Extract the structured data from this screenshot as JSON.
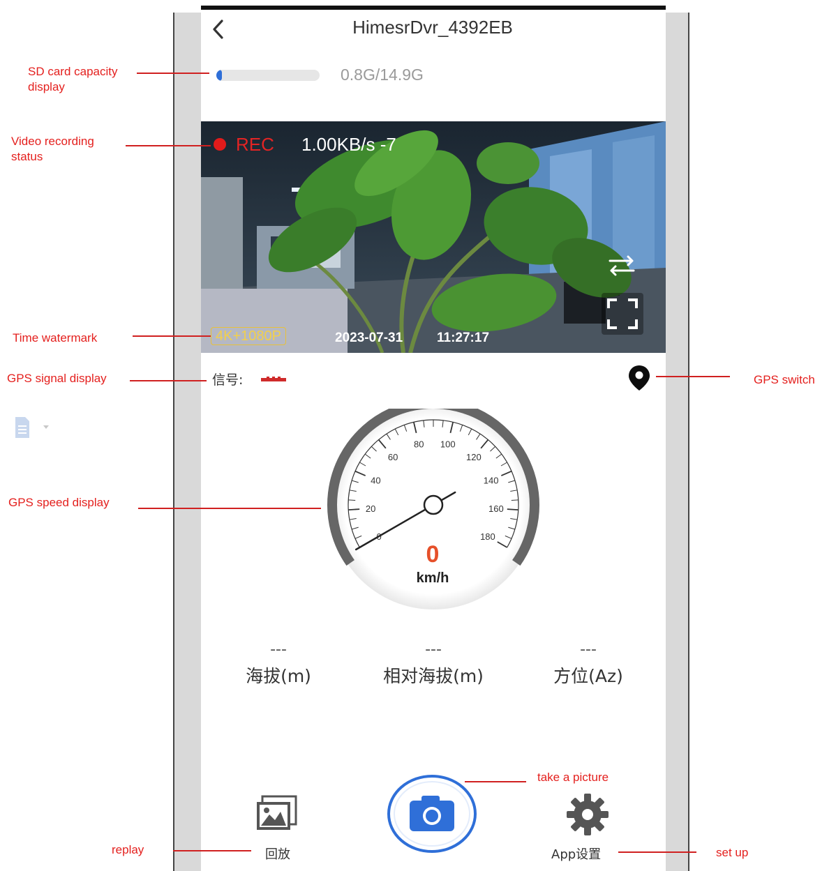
{
  "header": {
    "title": "HimesrDvr_4392EB"
  },
  "storage": {
    "used_fraction": 0.054,
    "label": "0.8G/14.9G"
  },
  "video": {
    "rec_label": "REC",
    "bitrate": "1.00KB/s -7",
    "resolution_badge": "4K+1080P",
    "date": "2023-07-31",
    "time": "11:27:17"
  },
  "gps": {
    "signal_label": "信号:",
    "speed": {
      "value": "0",
      "unit": "km/h",
      "max": 180,
      "current": 0,
      "tick_labels": [
        "0",
        "20",
        "40",
        "60",
        "80",
        "100",
        "120",
        "140",
        "160",
        "180"
      ]
    }
  },
  "stats": [
    {
      "value": "---",
      "label": "海拔(m)"
    },
    {
      "value": "---",
      "label": "相对海拔(m)"
    },
    {
      "value": "---",
      "label": "方位(Az)"
    }
  ],
  "bottom_bar": {
    "replay_label": "回放",
    "settings_label": "App设置"
  },
  "annotations": {
    "sd_card": "SD card capacity\ndisplay",
    "recording": "Video recording\nstatus",
    "time_watermark": "Time watermark",
    "gps_signal": "GPS signal display",
    "gps_switch": "GPS switch",
    "gps_speed": "GPS speed display",
    "take_picture": "take a picture",
    "replay": "replay",
    "set_up": "set up"
  },
  "colors": {
    "accent": "#2f6fd8",
    "rec_red": "#e21b1b",
    "speed_orange": "#e6502a",
    "annotation_red": "#e4201e"
  }
}
